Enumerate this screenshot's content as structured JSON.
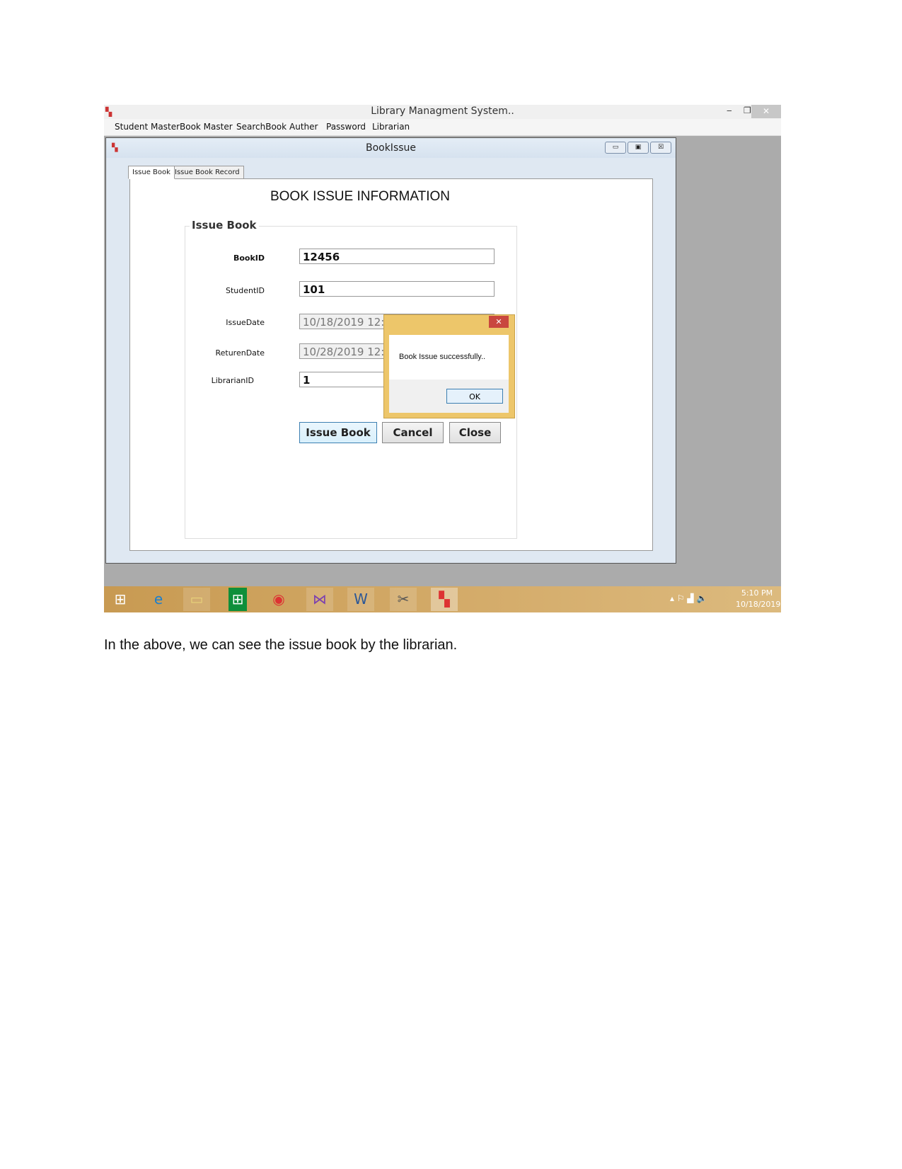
{
  "window": {
    "title": "Library Managment System..",
    "minimize": "‒",
    "restore": "❐",
    "close": "✕"
  },
  "menu": [
    "Student Master",
    "Book Master",
    "SearchBook",
    "Auther",
    "Password",
    "Librarian"
  ],
  "child": {
    "title": "BookIssue",
    "minimize": "▭",
    "restore": "▣",
    "close": "☒"
  },
  "tabs": [
    "Issue Book",
    "Issue Book Record"
  ],
  "form": {
    "heading": "BOOK ISSUE INFORMATION",
    "group": "Issue Book",
    "fields": [
      {
        "label": "BookID",
        "value": "12456"
      },
      {
        "label": "StudentID",
        "value": "101"
      },
      {
        "label": "IssueDate",
        "value": "10/18/2019 12:00"
      },
      {
        "label": "ReturenDate",
        "value": "10/28/2019 12:00"
      },
      {
        "label": "LibrarianID",
        "value": "1"
      }
    ],
    "buttons": [
      "Issue Book",
      "Cancel",
      "Close"
    ]
  },
  "dialog": {
    "message": "Book Issue successfully..",
    "ok": "OK",
    "close": "✕"
  },
  "taskbar": {
    "time": "5:10 PM",
    "date": "10/18/2019",
    "apps": [
      "windows-start",
      "internet-explorer",
      "file-explorer",
      "store",
      "chrome",
      "visual-studio",
      "word",
      "tools",
      "library-app"
    ]
  },
  "caption": "In the above, we can see the issue book by the librarian."
}
